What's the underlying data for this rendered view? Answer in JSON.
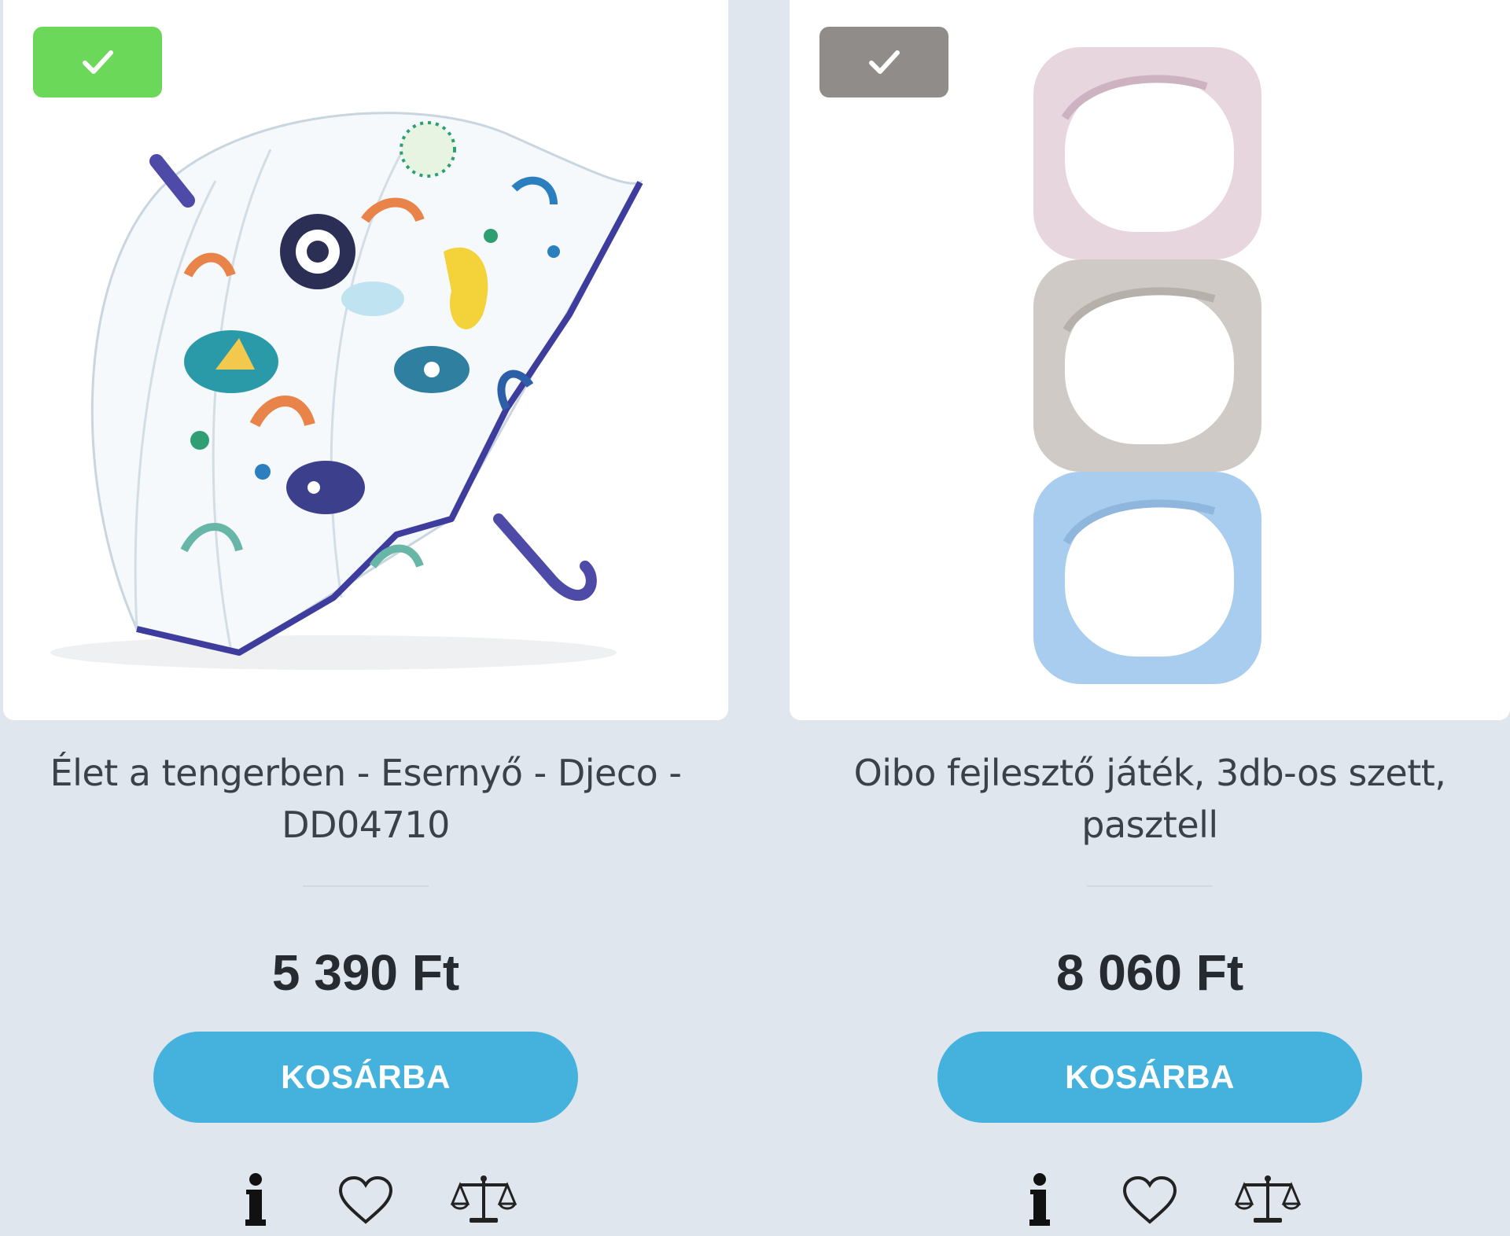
{
  "colors": {
    "page_bg": "#dfe6ee",
    "button": "#45b2dd",
    "badge_green": "#6bd85a",
    "badge_gray": "#8f8c89"
  },
  "products": [
    {
      "title": "Élet a tengerben - Esernyő - Djeco - DD04710",
      "price": "5 390 Ft",
      "button_label": "KOSÁRBA",
      "badge_color": "#6bd85a",
      "badge_icon": "check-icon",
      "image": "umbrella-with-sea-life-print",
      "icons": [
        "info-icon",
        "heart-icon",
        "compare-scale-icon"
      ]
    },
    {
      "title": "Oibo fejlesztő játék, 3db-os szett, pasztell",
      "price": "8 060 Ft",
      "button_label": "KOSÁRBA",
      "badge_color": "#8f8c89",
      "badge_icon": "check-icon",
      "image": "three-stacked-pastel-cubes",
      "icons": [
        "info-icon",
        "heart-icon",
        "compare-scale-icon"
      ]
    }
  ]
}
